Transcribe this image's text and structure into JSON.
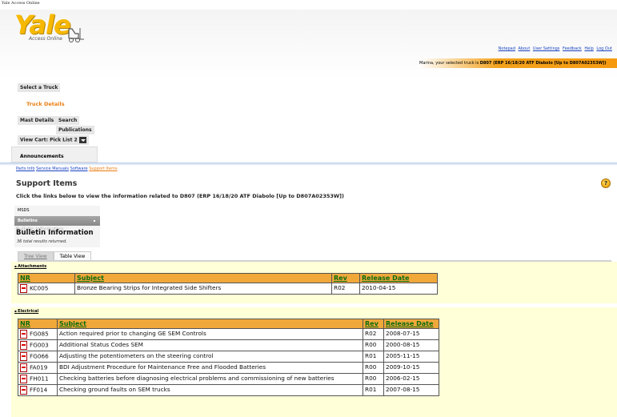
{
  "window": {
    "title": "Yale Access Online"
  },
  "brand": {
    "logo": "Yale",
    "tagline": "Access Online",
    "accent": "#f7b800"
  },
  "top_links": [
    "Notepad",
    "About",
    "User Settings",
    "Feedback",
    "Help",
    "Log Out"
  ],
  "truck_bar": {
    "prefix": "Marina, your selected truck is ",
    "truck": "D807 (ERP 16/18/20 ATF Diabolo [Up to D807A02353W])"
  },
  "nav": {
    "select_truck": "Select a Truck",
    "truck_details": "Truck Details",
    "mast_details": "Mast Details",
    "search": "Search",
    "publications": "Publications",
    "view_cart": "View Cart: Pick List 2",
    "announcements": "Announcements"
  },
  "breadcrumbs": [
    "Parts Info",
    "Service Manuals",
    "Software",
    "Support Items"
  ],
  "page": {
    "title": "Support Items",
    "subtitle": "Click the links below to view the information related to D807 (ERP 16/18/20 ATF Diabolo [Up to D807A02353W])"
  },
  "doc_menu": {
    "items": [
      "MSDS",
      "Bulletins"
    ],
    "info_title": "Bulletin Information",
    "ghost": "Bulletin Information",
    "results": "36 total results returned."
  },
  "view_tabs": [
    "Tree View",
    "Table View"
  ],
  "columns": {
    "nr": "NR",
    "subject": "Subject",
    "rev": "Rev",
    "date": "Release Date"
  },
  "sections": [
    {
      "name": "Attachments",
      "rows": [
        {
          "nr": "KC005",
          "subject": "Bronze Bearing Strips for Integrated Side Shifters",
          "rev": "R02",
          "date": "2010-04-15"
        }
      ]
    },
    {
      "name": "Electrical",
      "rows": [
        {
          "nr": "FG085",
          "subject": "Action required prior to changing GE SEM Controls",
          "rev": "R02",
          "date": "2008-07-15"
        },
        {
          "nr": "FG003",
          "subject": "Additional Status Codes SEM",
          "rev": "R00",
          "date": "2000-08-15"
        },
        {
          "nr": "FG066",
          "subject": "Adjusting the potentiometers on the steering control",
          "rev": "R01",
          "date": "2005-11-15"
        },
        {
          "nr": "FA019",
          "subject": "BDI Adjustment Procedure for Maintenance Free and Flooded Batteries",
          "rev": "R00",
          "date": "2009-10-15"
        },
        {
          "nr": "FH011",
          "subject": "Checking batteries before diagnosing electrical problems and commissioning of new batteries",
          "rev": "R00",
          "date": "2006-02-15"
        },
        {
          "nr": "FF014",
          "subject": "Checking ground faults on SEM trucks",
          "rev": "R01",
          "date": "2007-08-15"
        }
      ]
    }
  ]
}
